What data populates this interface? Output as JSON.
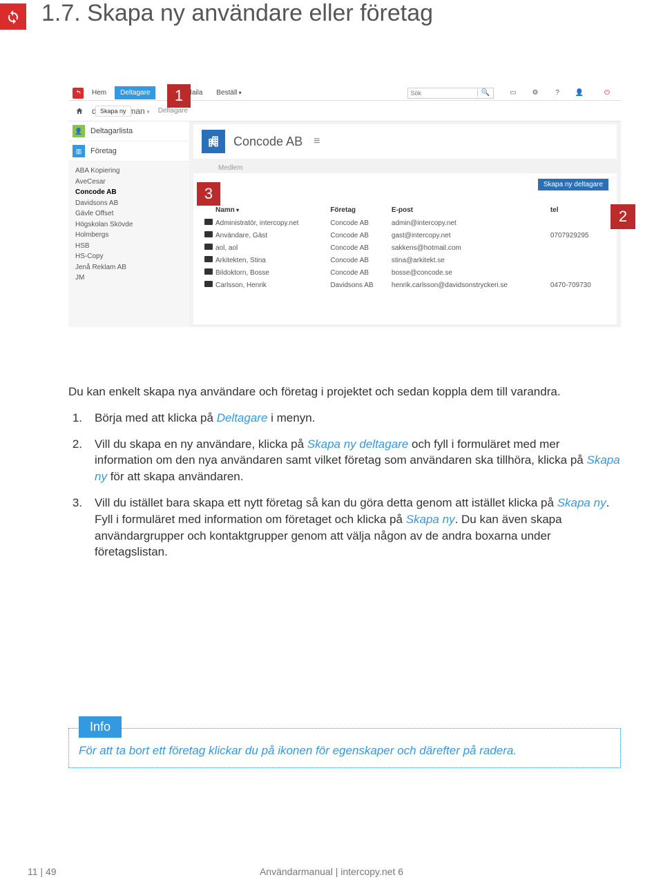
{
  "page": {
    "heading": "1.7. Skapa ny användare eller företag"
  },
  "callouts": {
    "c1": "1",
    "c2": "2",
    "c3": "3"
  },
  "app": {
    "nav": {
      "hem": "Hem",
      "deltagare": "Deltagare",
      "maila": "Maila",
      "bestall": "Beställ"
    },
    "search_placeholder": "Sök",
    "crumb_project": "demo femman",
    "crumb_sub": "Deltagare",
    "side": {
      "deltagarlista": "Deltagarlista",
      "foretag": "Företag",
      "skapa_ny": "Skapa ny"
    },
    "companies": [
      "ABA Kopiering",
      "AveCesar",
      "Concode AB",
      "Davidsons AB",
      "Gävle Offset",
      "Högskolan Skövde",
      "Holmbergs",
      "HSB",
      "HS-Copy",
      "Jenå Reklam AB",
      "JM"
    ],
    "company_title": "Concode AB",
    "medlem_label": "Medlem",
    "skapa_deltagare_btn": "Skapa ny deltagare",
    "table": {
      "headers": {
        "namn": "Namn",
        "foretag": "Företag",
        "epost": "E-post",
        "tel": "tel"
      },
      "rows": [
        {
          "namn": "Administratör, intercopy.net",
          "foretag": "Concode AB",
          "epost": "admin@intercopy.net",
          "tel": ""
        },
        {
          "namn": "Användare, Gäst",
          "foretag": "Concode AB",
          "epost": "gast@intercopy.net",
          "tel": "0707929295"
        },
        {
          "namn": "aol, aol",
          "foretag": "Concode AB",
          "epost": "sakkens@hotmail.com",
          "tel": ""
        },
        {
          "namn": "Arkitekten, Stina",
          "foretag": "Concode AB",
          "epost": "stina@arkitekt.se",
          "tel": ""
        },
        {
          "namn": "Bildoktorn, Bosse",
          "foretag": "Concode AB",
          "epost": "bosse@concode.se",
          "tel": ""
        },
        {
          "namn": "Carlsson, Henrik",
          "foretag": "Davidsons AB",
          "epost": "henrik.carlsson@davidsonstryckeri.se",
          "tel": "0470-709730"
        }
      ]
    }
  },
  "body": {
    "intro": "Du kan enkelt skapa nya användare och företag i projektet och sedan koppla dem till varandra.",
    "item1_a": "Börja med att klicka på ",
    "item1_link": "Deltagare",
    "item1_b": " i menyn.",
    "item2_a": "Vill du skapa en ny användare, klicka på ",
    "item2_link1": "Skapa ny deltagare",
    "item2_b": " och fyll i formuläret med mer information om den nya användaren samt vilket företag som användaren ska tillhöra, klicka på ",
    "item2_link2": "Skapa ny",
    "item2_c": " för att skapa användaren.",
    "item3_a": "Vill du istället bara skapa ett nytt företag så kan du göra detta genom att istället klicka på ",
    "item3_link1": "Skapa ny",
    "item3_b": ". Fyll i formuläret med information om företaget och klicka på ",
    "item3_link2": "Skapa ny",
    "item3_c": ". Du kan även skapa användargrupper och kontaktgrupper genom att välja någon av de andra boxarna under företagslistan."
  },
  "info": {
    "label": "Info",
    "text": "För att ta bort ett företag klickar du på ikonen för egenskaper och därefter på radera."
  },
  "footer": {
    "left": "11 | 49",
    "center": "Användarmanual  |  intercopy.net 6"
  }
}
